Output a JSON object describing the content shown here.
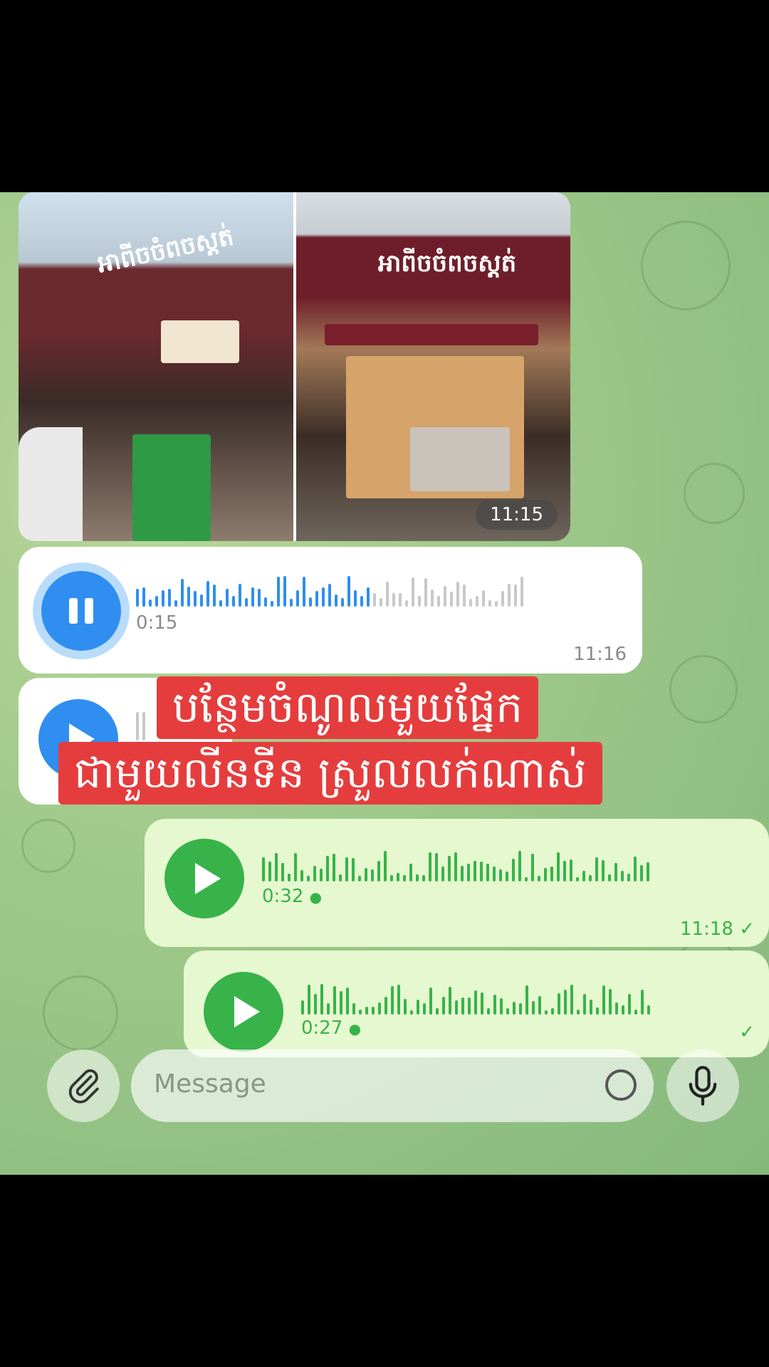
{
  "photos": {
    "left_sign": "អាពីចចំពចស្តត់",
    "right_sign": "អាពីចចំពចស្តត់",
    "time": "11:15"
  },
  "voice_messages": [
    {
      "direction": "in",
      "state": "playing",
      "duration": "0:15",
      "time": "11:16",
      "progress": 0.6
    },
    {
      "direction": "in",
      "state": "paused",
      "duration": "",
      "time": ""
    },
    {
      "direction": "out",
      "state": "paused",
      "duration": "0:32",
      "time": "11:18",
      "read_status": "✓"
    },
    {
      "direction": "out",
      "state": "paused",
      "duration": "0:27",
      "time": "",
      "read_status": "✓"
    }
  ],
  "caption": {
    "line1": "បន្ថែមចំណូលមួយផ្នែក",
    "line2": "ជាមួយលីនទីន ស្រួលលក់ណាស់"
  },
  "composer": {
    "placeholder": "Message"
  },
  "colors": {
    "incoming_accent": "#2f8ef0",
    "outgoing_accent": "#37b34a",
    "caption_bg": "#e53d3d"
  }
}
